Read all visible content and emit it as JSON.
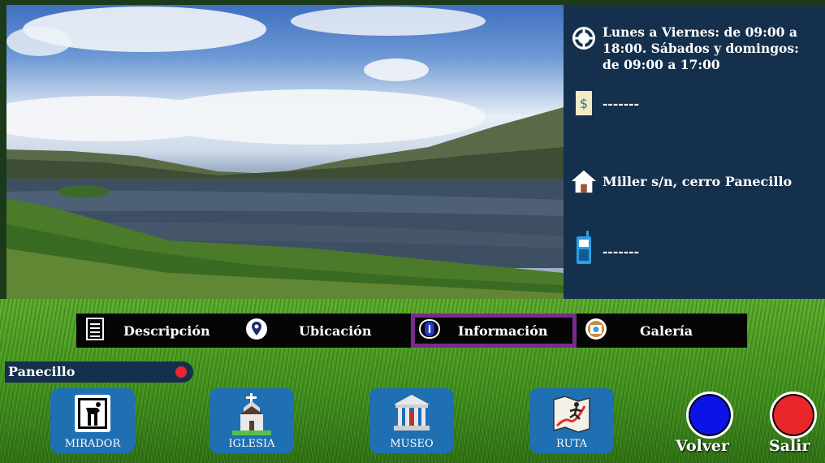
{
  "info": {
    "hours": "Lunes a Viernes: de  09:00 a 18:00. Sábados y  domingos: de 09:00 a 17:00",
    "price": "-------",
    "address": "Miller s/n, cerro Panecillo",
    "phone": "-------"
  },
  "tabs": {
    "descripcion": "Descripción",
    "ubicacion": "Ubicación",
    "informacion": "Información",
    "galeria": "Galería",
    "active": "Información"
  },
  "place": {
    "name": "Panecillo"
  },
  "nav": {
    "mirador": "MIRADOR",
    "iglesia": "IGLESIA",
    "museo": "MUSEO",
    "ruta": "RUTA"
  },
  "actions": {
    "volver": "Volver",
    "salir": "Salir"
  },
  "colors": {
    "panel": "#15304d",
    "tab_active_border": "#7a2a8a",
    "nav_button": "#1f6fb3",
    "volver": "#0a14e6",
    "salir": "#e8262b"
  },
  "icons": {
    "hours": "clock-icon",
    "price": "money-icon",
    "address": "house-icon",
    "phone": "phone-icon",
    "descripcion": "document-icon",
    "ubicacion": "location-pin-icon",
    "informacion": "info-icon",
    "galeria": "camera-icon"
  }
}
